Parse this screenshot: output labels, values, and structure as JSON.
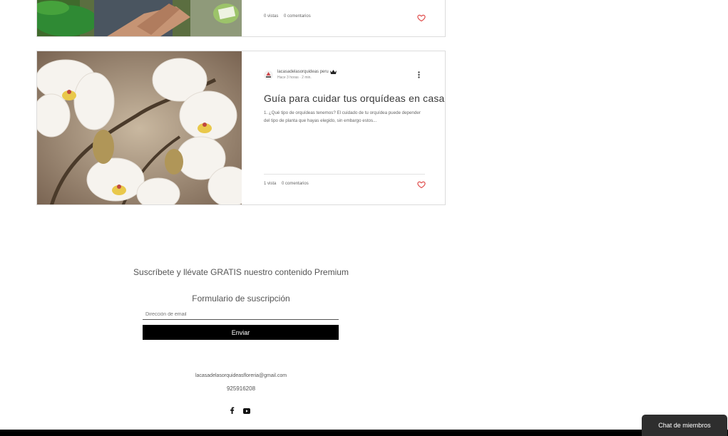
{
  "posts": [
    {
      "stats": {
        "views": "0 vistas",
        "comments": "0 comentarios"
      }
    },
    {
      "author": "lacasadelasorquideas peru",
      "meta": "Hace 3 horas · 2 min.",
      "title": "Guía para cuidar tus orquídeas en casa",
      "excerpt": "1. ¿Qué tipo de orquídeas tenemos? El cuidado de tu orquídea puede depender del tipo de planta que hayas elegido, sin embargo estos...",
      "stats": {
        "views": "1 vista",
        "comments": "0 comentarios"
      }
    }
  ],
  "subscribe": {
    "promo": "Suscríbete y llévate GRATIS nuestro contenido Premium",
    "form_title": "Formulario de suscripción",
    "email_placeholder": "Dirección de email",
    "submit_label": "Enviar"
  },
  "contact": {
    "email": "lacasadelasorquideasfloreria@gmail.com",
    "phone": "925916208"
  },
  "chat": {
    "label": "Chat de miembros"
  },
  "colors": {
    "heart": "#e0504f",
    "button": "#000000",
    "chat_bg": "#2e2e2e"
  },
  "icons": [
    "crown-icon",
    "more-icon",
    "heart-icon",
    "facebook-icon",
    "youtube-icon"
  ]
}
